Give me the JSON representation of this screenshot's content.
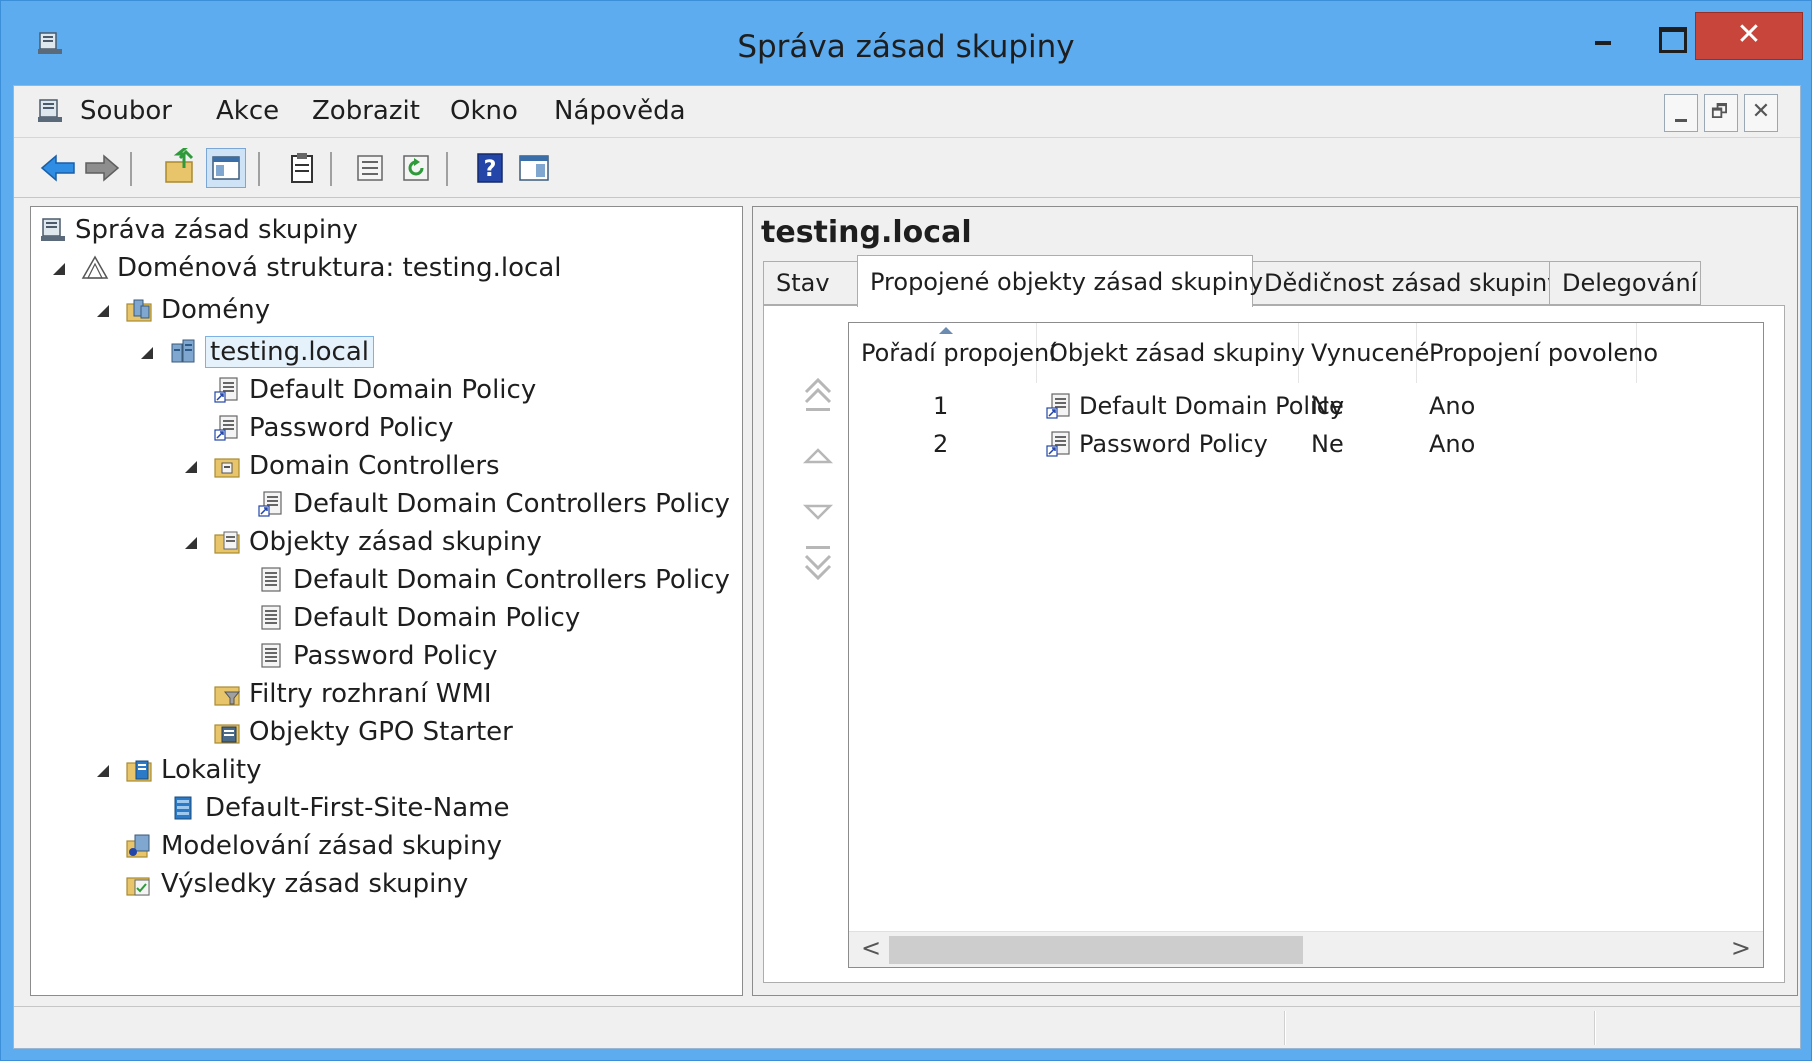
{
  "window": {
    "title": "Správa zásad skupiny",
    "close_glyph": "✕"
  },
  "menu": {
    "items": [
      "Soubor",
      "Akce",
      "Zobrazit",
      "Okno",
      "Nápověda"
    ],
    "mdi_close_glyph": "✕"
  },
  "toolbar": {
    "icons": [
      "back-arrow-icon",
      "forward-arrow-icon",
      "up-folder-icon",
      "show-hide-console-tree-icon",
      "clipboard-icon",
      "properties-icon",
      "refresh-icon",
      "help-icon",
      "show-action-pane-icon"
    ]
  },
  "tree": {
    "root": "Správa zásad skupiny",
    "forest": "Doménová struktura: testing.local",
    "domains": "Domény",
    "domain": "testing.local",
    "ddp_link": "Default Domain Policy",
    "pwd_link": "Password Policy",
    "dc_ou": "Domain Controllers",
    "ddcp_link": "Default Domain Controllers Policy",
    "gpo_container": "Objekty zásad skupiny",
    "gpo_ddcp": "Default Domain Controllers Policy",
    "gpo_ddp": "Default Domain Policy",
    "gpo_pwd": "Password Policy",
    "wmi": "Filtry rozhraní WMI",
    "starter": "Objekty GPO Starter",
    "sites": "Lokality",
    "site1": "Default-First-Site-Name",
    "modeling": "Modelování zásad skupiny",
    "results": "Výsledky zásad skupiny"
  },
  "right": {
    "title": "testing.local",
    "tabs": [
      "Stav",
      "Propojené objekty zásad skupiny",
      "Dědičnost zásad skupiny",
      "Delegování"
    ],
    "active_tab": "Propojené objekty zásad skupiny",
    "columns": [
      "Pořadí propojení",
      "Objekt zásad skupiny",
      "Vynucené",
      "Propojení povoleno"
    ],
    "rows": [
      {
        "order": "1",
        "gpo": "Default Domain Policy",
        "enforced": "Ne",
        "enabled": "Ano"
      },
      {
        "order": "2",
        "gpo": "Password Policy",
        "enforced": "Ne",
        "enabled": "Ano"
      }
    ],
    "scroll_left": "<",
    "scroll_right": ">"
  },
  "colors": {
    "title_bar": "#5dacf0",
    "close_button": "#c7453a",
    "selection": "#e5f1fb"
  }
}
